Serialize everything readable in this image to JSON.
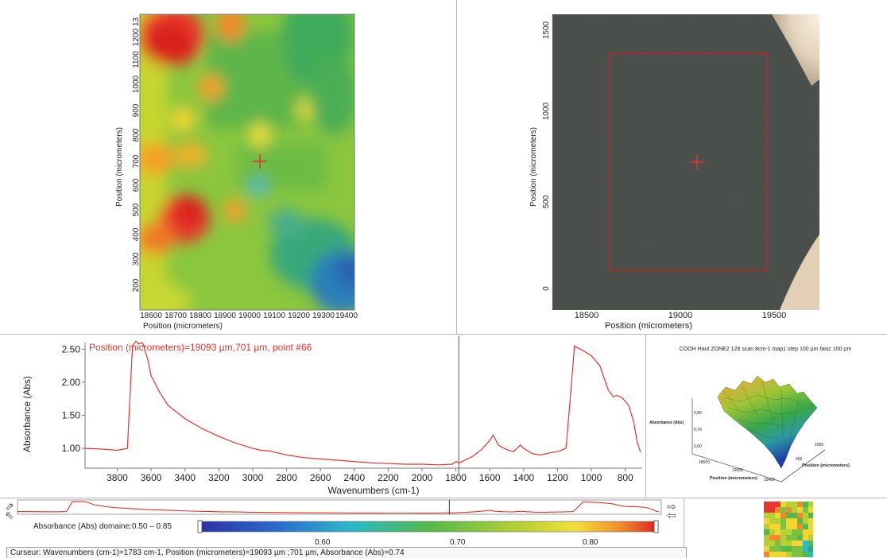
{
  "map_panel": {
    "xlabel": "Position (micrometers)",
    "ylabel": "Position (micrometers)",
    "x_ticks": [
      "18600",
      "18700",
      "18800",
      "18900",
      "19000",
      "19100",
      "19200",
      "19300",
      "19400"
    ],
    "y_ticks": [
      "1200 13",
      "1100",
      "1000",
      "900",
      "800",
      "700",
      "600",
      "500",
      "400",
      "300",
      "200"
    ]
  },
  "image_panel": {
    "xlabel": "Position (micrometers)",
    "ylabel": "Position (micrometers)",
    "x_ticks": [
      "18500",
      "19000",
      "19500"
    ],
    "y_ticks": [
      "1500",
      "1000",
      "500",
      "0"
    ]
  },
  "spectrum_panel": {
    "annotation": "Position (micrometers)=19093 µm,701 µm, point #66",
    "xlabel": "Wavenumbers (cm-1)",
    "ylabel": "Absorbance (Abs)",
    "x_ticks": [
      "3800",
      "3600",
      "3400",
      "3200",
      "3000",
      "2800",
      "2600",
      "2400",
      "2200",
      "2000",
      "1800",
      "1600",
      "1400",
      "1200",
      "1000",
      "800"
    ],
    "y_ticks": [
      "2.50",
      "2.00",
      "1.50",
      "1.00"
    ]
  },
  "surface_panel": {
    "title": "COOH Haut ZONE2 128 scan 8cm-1 map1 step 100 µm faisc 100 µm",
    "z_label": "Absorbance (Abs)",
    "z_ticks": [
      "0,80",
      "0,70",
      "0,60"
    ],
    "x_label": "Position (micrometers)",
    "y_label": "Position (micrometers)",
    "x_ticks": [
      "18600",
      "19000",
      "19400"
    ],
    "y_ticks": [
      "1000",
      "400"
    ]
  },
  "colorscale": {
    "label": "Absorbance (Abs) domaine:0.50 – 0.85",
    "ticks": [
      "0.60",
      "0.70",
      "0.80"
    ]
  },
  "status_bar": {
    "text": "Curseur: Wavenumbers (cm-1)=1783 cm-1, Position (micrometers)=19093 µm ;701 µm, Absorbance (Abs)=0.74"
  },
  "icons": {
    "left_arrows": "double-arrow-left-icon",
    "right_arrows": "double-arrow-right-icon"
  },
  "colors": {
    "spectrum_line": "#e8322a",
    "crosshair": "#e8322a",
    "selection_box": "#d42020"
  },
  "chart_data": {
    "type": "line",
    "title": "",
    "xlabel": "Wavenumbers (cm-1)",
    "ylabel": "Absorbance (Abs)",
    "xlim": [
      3990,
      700
    ],
    "ylim": [
      0.7,
      2.6
    ],
    "cursor_x": 1783,
    "series": [
      {
        "x": [
          3990,
          3900,
          3800,
          3740,
          3710,
          3690,
          3670,
          3650,
          3620,
          3600,
          3550,
          3500,
          3400,
          3300,
          3200,
          3100,
          3000,
          2950,
          2900,
          2800,
          2700,
          2600,
          2500,
          2400,
          2350,
          2300,
          2200,
          2100,
          2000,
          1900,
          1820,
          1800,
          1780,
          1700,
          1650,
          1600,
          1580,
          1550,
          1500,
          1460,
          1420,
          1400,
          1350,
          1300,
          1250,
          1200,
          1150,
          1120,
          1100,
          1080,
          1050,
          1000,
          950,
          900,
          870,
          850,
          820,
          780,
          750,
          730,
          710
        ],
        "y": [
          1.0,
          0.99,
          0.97,
          1.0,
          2.55,
          2.62,
          2.58,
          2.6,
          2.35,
          2.1,
          1.85,
          1.65,
          1.45,
          1.3,
          1.18,
          1.08,
          1.0,
          0.97,
          0.96,
          0.9,
          0.86,
          0.84,
          0.82,
          0.8,
          0.79,
          0.78,
          0.77,
          0.76,
          0.76,
          0.75,
          0.76,
          0.8,
          0.78,
          0.88,
          0.98,
          1.12,
          1.2,
          1.05,
          0.98,
          0.95,
          1.05,
          1.0,
          0.92,
          0.9,
          0.93,
          0.95,
          1.0,
          1.9,
          2.55,
          2.52,
          2.48,
          2.4,
          2.25,
          1.88,
          1.78,
          1.8,
          1.77,
          1.65,
          1.4,
          1.1,
          0.94
        ]
      }
    ]
  }
}
